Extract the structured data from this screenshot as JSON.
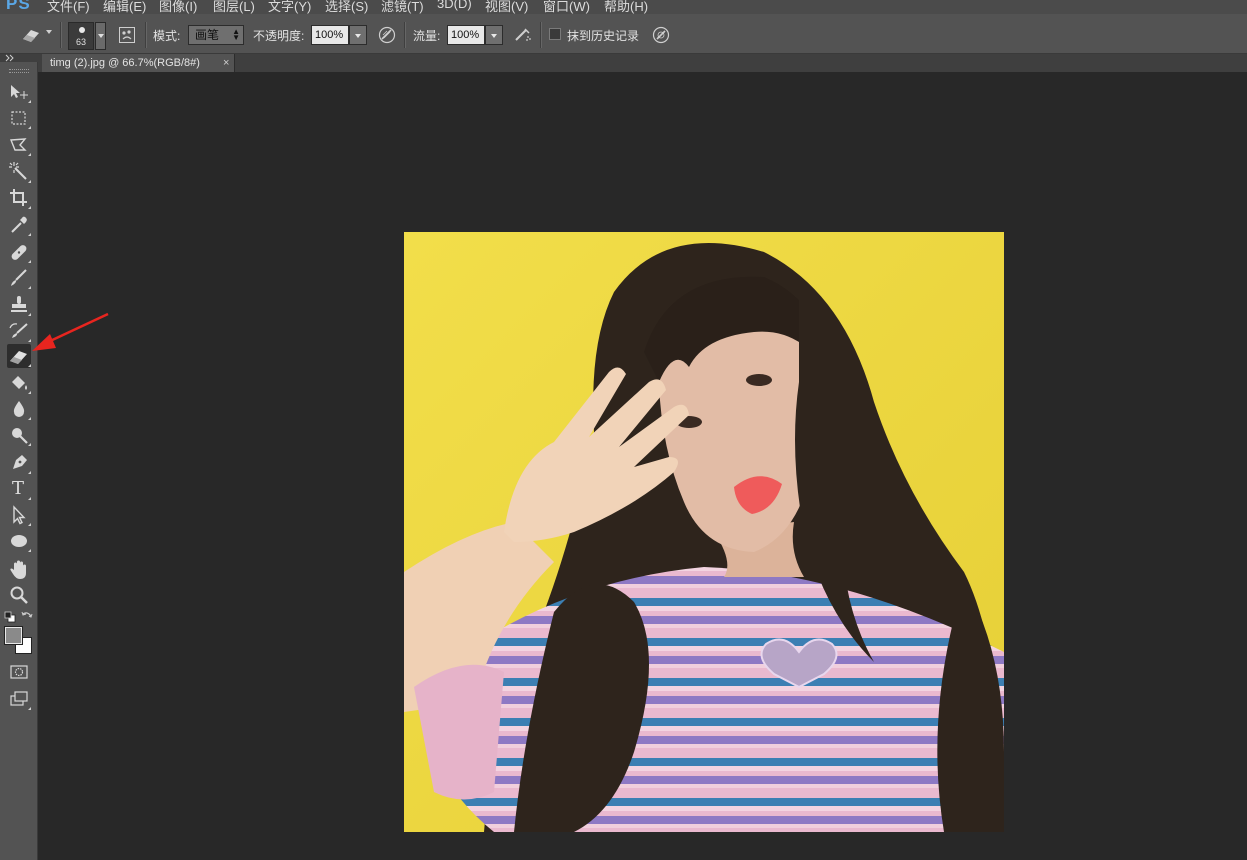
{
  "app": {
    "logo": "PS"
  },
  "menu": {
    "items": [
      "文件(F)",
      "编辑(E)",
      "图像(I)",
      "图层(L)",
      "文字(Y)",
      "选择(S)",
      "滤镜(T)",
      "3D(D)",
      "视图(V)",
      "窗口(W)",
      "帮助(H)"
    ]
  },
  "options": {
    "tool_icon": "eraser-icon",
    "brush_size": "63",
    "mode_label": "模式:",
    "mode_value": "画笔",
    "opacity_label": "不透明度:",
    "opacity_value": "100%",
    "flow_label": "流量:",
    "flow_value": "100%",
    "history_label": "抹到历史记录",
    "history_checked": false
  },
  "toolbox": {
    "tools": [
      "move-tool-icon",
      "rectangular-marquee-icon",
      "polygonal-lasso-icon",
      "magic-wand-icon",
      "crop-icon",
      "eyedropper-icon",
      "healing-brush-icon",
      "brush-icon",
      "clone-stamp-icon",
      "history-brush-icon",
      "eraser-icon",
      "paint-bucket-icon",
      "blur-icon",
      "dodge-icon",
      "pen-icon",
      "type-icon",
      "path-selection-icon",
      "ellipse-icon",
      "hand-icon",
      "zoom-icon"
    ],
    "active_tool": "eraser-icon",
    "type_glyph": "T",
    "foreground_color": "#8a8a8a",
    "background_color": "#ffffff"
  },
  "document": {
    "tab_title": "timg (2).jpg @ 66.7%(RGB/8#)",
    "close_glyph": "×"
  },
  "colors": {
    "photo_background": "#f0dc45",
    "annotation_arrow": "#e8251f"
  }
}
